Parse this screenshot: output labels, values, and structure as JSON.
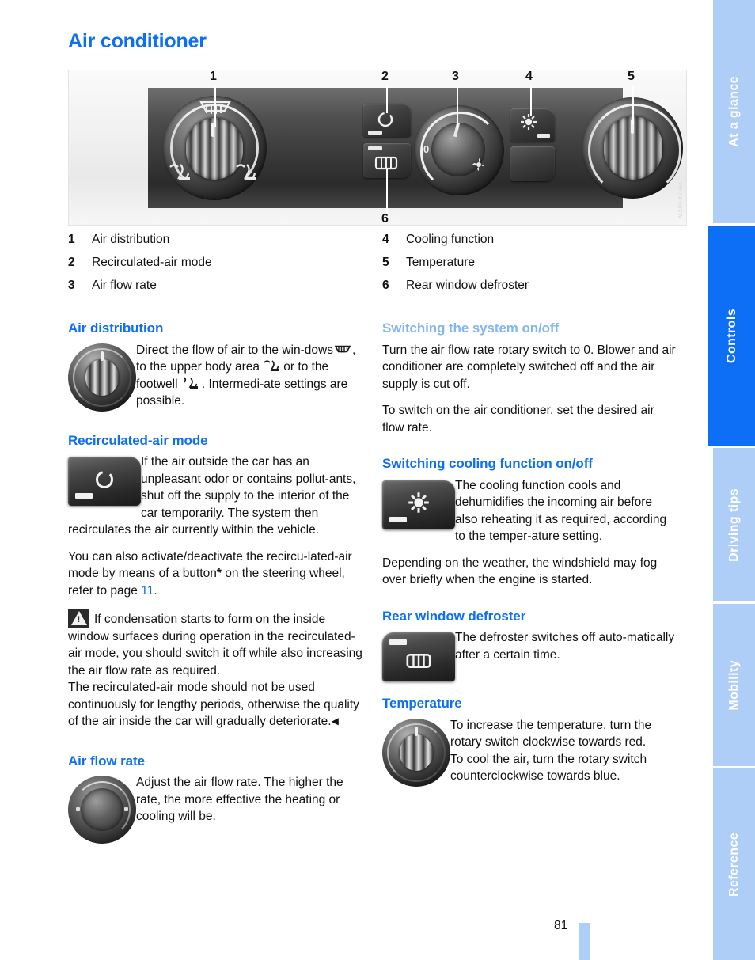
{
  "page": {
    "title": "Air conditioner",
    "number": "81",
    "figure_watermark": "VH-34-00XW"
  },
  "sidebar": {
    "tabs": [
      {
        "label": "At a glance",
        "active": false
      },
      {
        "label": "Controls",
        "active": true
      },
      {
        "label": "Driving tips",
        "active": false
      },
      {
        "label": "Mobility",
        "active": false
      },
      {
        "label": "Reference",
        "active": false
      }
    ]
  },
  "figure": {
    "callouts": [
      "1",
      "2",
      "3",
      "4",
      "5",
      "6"
    ]
  },
  "legend": {
    "left": [
      {
        "num": "1",
        "label": "Air distribution"
      },
      {
        "num": "2",
        "label": "Recirculated-air mode"
      },
      {
        "num": "3",
        "label": "Air flow rate"
      }
    ],
    "right": [
      {
        "num": "4",
        "label": "Cooling function"
      },
      {
        "num": "5",
        "label": "Temperature"
      },
      {
        "num": "6",
        "label": "Rear window defroster"
      }
    ]
  },
  "left_column": {
    "air_distribution": {
      "heading": "Air distribution",
      "text_a": "Direct the flow of air to the win-dows",
      "text_b": ", to the upper body area",
      "text_c": "or to the footwell",
      "text_d": ". Intermedi-ate settings are possible."
    },
    "recirculated_air": {
      "heading": "Recirculated-air mode",
      "para1": "If the air outside the car has an unpleasant odor or contains pollut-ants, shut off the supply to the interior of the car temporarily. The system then recirculates the air currently within the vehicle.",
      "para2_a": "You can also activate/deactivate the recircu-lated-air mode by means of a button",
      "para2_star": "*",
      "para2_b": "on the steering wheel, refer to page",
      "para2_page": "11",
      "para2_c": ".",
      "warning": "If condensation starts to form on the inside window surfaces during operation in the recirculated-air mode, you should switch it off while also increasing the air flow rate as required.",
      "warning2": "The recirculated-air mode should not be used continuously for lengthy periods, otherwise the quality of the air inside the car will gradually deteriorate.",
      "endmark": "◀"
    },
    "air_flow_rate": {
      "heading": "Air flow rate",
      "text": "Adjust the air flow rate. The higher the rate, the more effective the heating or cooling will be."
    }
  },
  "right_column": {
    "system_on_off": {
      "heading": "Switching the system on/off",
      "para1": "Turn the air flow rate rotary switch to 0. Blower and air conditioner are completely switched off and the air supply is cut off.",
      "para2": "To switch on the air conditioner, set the desired air flow rate."
    },
    "cooling_on_off": {
      "heading": "Switching cooling function on/off",
      "para1": "The cooling function cools and dehumidifies the incoming air before also reheating it as required, according to the temper-ature setting.",
      "para2": "Depending on the weather, the windshield may fog over briefly when the engine is started."
    },
    "rear_defroster": {
      "heading": "Rear window defroster",
      "text": "The defroster switches off auto-matically after a certain time."
    },
    "temperature": {
      "heading": "Temperature",
      "text": "To increase the temperature, turn the rotary switch clockwise towards red.\nTo cool the air, turn the rotary switch counterclockwise towards blue."
    }
  },
  "colors": {
    "heading_blue": "#0c6ff5",
    "heading_blue_faded": "#84b6f2",
    "sidebar_blue": "#aecdf7",
    "sidebar_active": "#0c6ff5"
  }
}
